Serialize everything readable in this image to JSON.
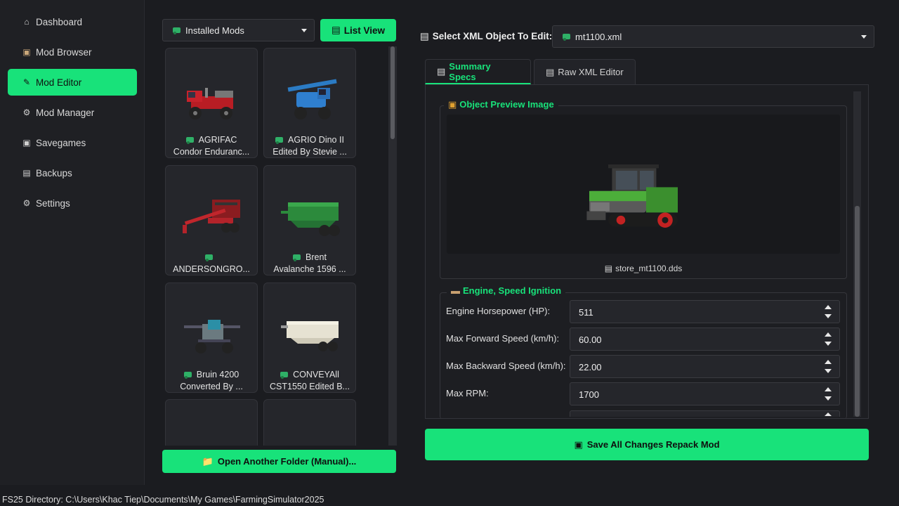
{
  "sidebar": {
    "items": [
      {
        "label": "Dashboard",
        "icon": "house-icon",
        "active": false
      },
      {
        "label": "Mod Browser",
        "icon": "box-icon",
        "active": false
      },
      {
        "label": "Mod Editor",
        "icon": "pencil-icon",
        "active": true
      },
      {
        "label": "Mod Manager",
        "icon": "gear-icon",
        "active": false
      },
      {
        "label": "Savegames",
        "icon": "floppy-icon",
        "active": false
      },
      {
        "label": "Backups",
        "icon": "archive-icon",
        "active": false
      },
      {
        "label": "Settings",
        "icon": "gear-icon",
        "active": false
      }
    ]
  },
  "modlist": {
    "filter_value": "Installed Mods",
    "view_button": "List View",
    "open_folder_button": "Open Another Folder (Manual)...",
    "cards": [
      {
        "line1": "AGRIFAC",
        "line2": "Condor Enduranc..."
      },
      {
        "line1": "AGRIO Dino II",
        "line2": "Edited By Stevie ..."
      },
      {
        "line1": "",
        "line2": "ANDERSONGRO..."
      },
      {
        "line1": "Brent",
        "line2": "Avalanche 1596 ..."
      },
      {
        "line1": "Bruin 4200",
        "line2": "Converted By ..."
      },
      {
        "line1": "CONVEYAll",
        "line2": "CST1550 Edited B..."
      },
      {
        "line1": "",
        "line2": ""
      },
      {
        "line1": "",
        "line2": ""
      }
    ]
  },
  "editor": {
    "select_label": "Select XML Object To Edit:",
    "selected_file": "mt1100.xml",
    "tabs": [
      {
        "label": "Summary Specs",
        "active": true
      },
      {
        "label": "Raw XML Editor",
        "active": false
      }
    ],
    "preview": {
      "title": "Object Preview Image",
      "filename": "store_mt1100.dds"
    },
    "engine": {
      "title": "Engine, Speed  Ignition",
      "fields": [
        {
          "label": "Engine Horsepower (HP):",
          "value": "511"
        },
        {
          "label": "Max Forward Speed (km/h):",
          "value": "60.00"
        },
        {
          "label": "Max Backward Speed (km/h):",
          "value": "22.00"
        },
        {
          "label": "Max RPM:",
          "value": "1700"
        }
      ]
    },
    "save_button": "Save All Changes  Repack Mod"
  },
  "status_bar": {
    "text": "FS25 Directory: C:\\Users\\Khac Tiep\\Documents\\My Games\\FarmingSimulator2025"
  },
  "colors": {
    "accent": "#18e27a",
    "background": "#1b1c20"
  }
}
